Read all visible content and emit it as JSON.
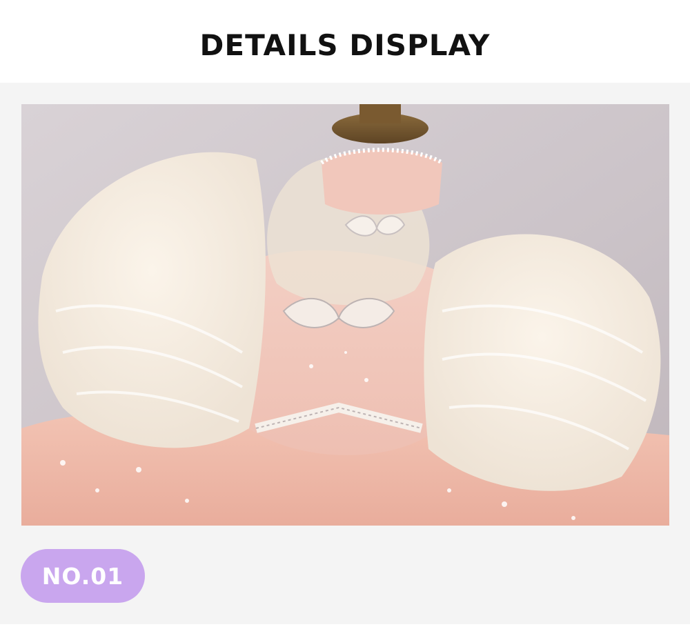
{
  "header": {
    "title": "DETAILS DISPLAY"
  },
  "photo": {
    "subject": "dress-detail-photo"
  },
  "badge": {
    "label": "NO.01",
    "color": "#c9a6ee"
  }
}
